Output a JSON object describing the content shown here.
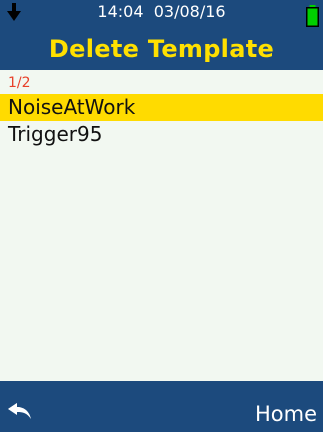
{
  "status_bar": {
    "time": "14:04",
    "date": "03/08/16",
    "download_icon": "down-arrow-icon",
    "battery_icon": "battery-icon",
    "battery_color": "#00d000"
  },
  "header": {
    "title": "Delete Template",
    "title_color": "#ffe000",
    "background": "#1c4a7d"
  },
  "list": {
    "page_indicator": "1/2",
    "items": [
      {
        "label": "NoiseAtWork",
        "selected": true
      },
      {
        "label": "Trigger95",
        "selected": false
      }
    ],
    "selected_color": "#ffdb00"
  },
  "footer": {
    "back_icon": "back-arrow-icon",
    "home_label": "Home"
  }
}
